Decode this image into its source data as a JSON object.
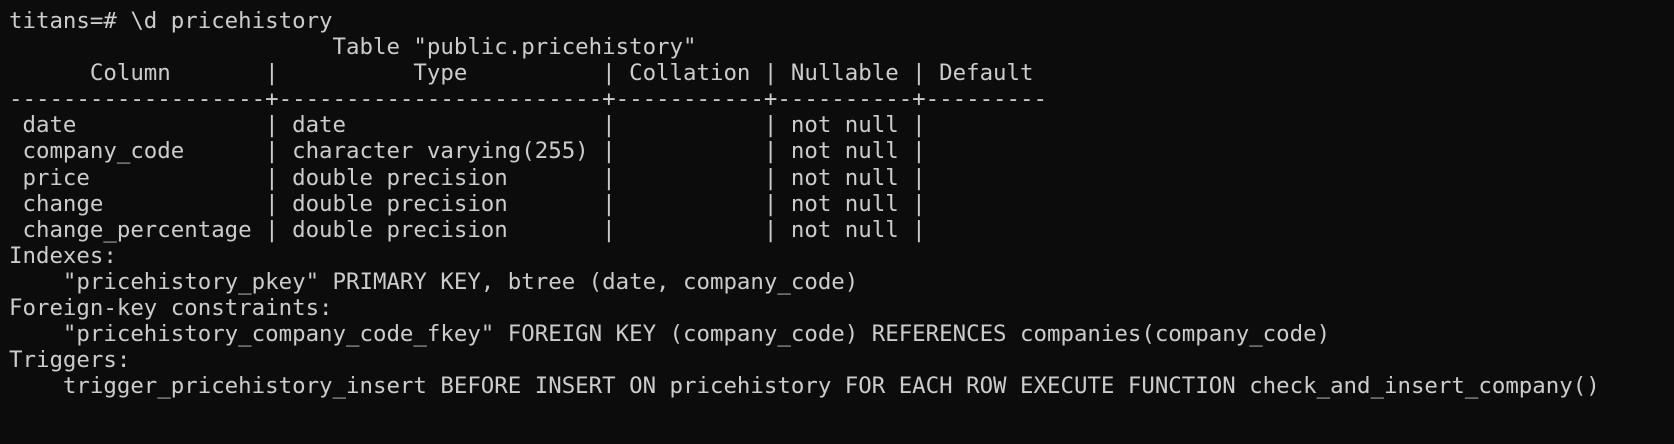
{
  "terminal": {
    "lines": [
      "titans=# \\d pricehistory",
      "                        Table \"public.pricehistory\"",
      "      Column       |          Type          | Collation | Nullable | Default",
      "-------------------+------------------------+-----------+----------+---------",
      " date              | date                   |           | not null |",
      " company_code      | character varying(255) |           | not null |",
      " price             | double precision       |           | not null |",
      " change            | double precision       |           | not null |",
      " change_percentage | double precision       |           | not null |",
      "Indexes:",
      "    \"pricehistory_pkey\" PRIMARY KEY, btree (date, company_code)",
      "Foreign-key constraints:",
      "    \"pricehistory_company_code_fkey\" FOREIGN KEY (company_code) REFERENCES companies(company_code)",
      "Triggers:",
      "    trigger_pricehistory_insert BEFORE INSERT ON pricehistory FOR EACH ROW EXECUTE FUNCTION check_and_insert_company()"
    ]
  }
}
